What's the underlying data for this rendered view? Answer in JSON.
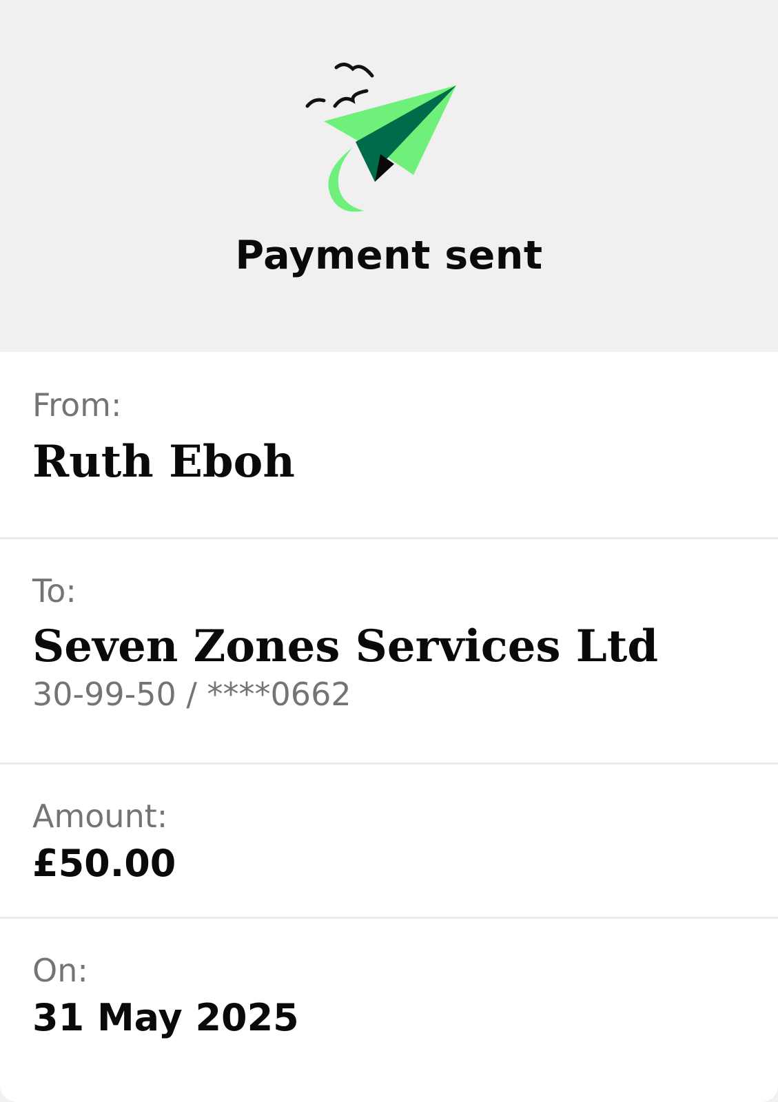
{
  "header": {
    "title": "Payment sent",
    "icon": "paper-plane-icon",
    "colors": {
      "background": "#f0f0f0",
      "plane_light": "#6ff07b",
      "plane_dark": "#006b4a"
    }
  },
  "from": {
    "label": "From:",
    "name": "Ruth Eboh"
  },
  "to": {
    "label": "To:",
    "name": "Seven Zones Services Ltd",
    "account": "30-99-50 / ****0662"
  },
  "amount": {
    "label": "Amount:",
    "value": "£50.00"
  },
  "date": {
    "label": "On:",
    "value": "31 May 2025"
  }
}
